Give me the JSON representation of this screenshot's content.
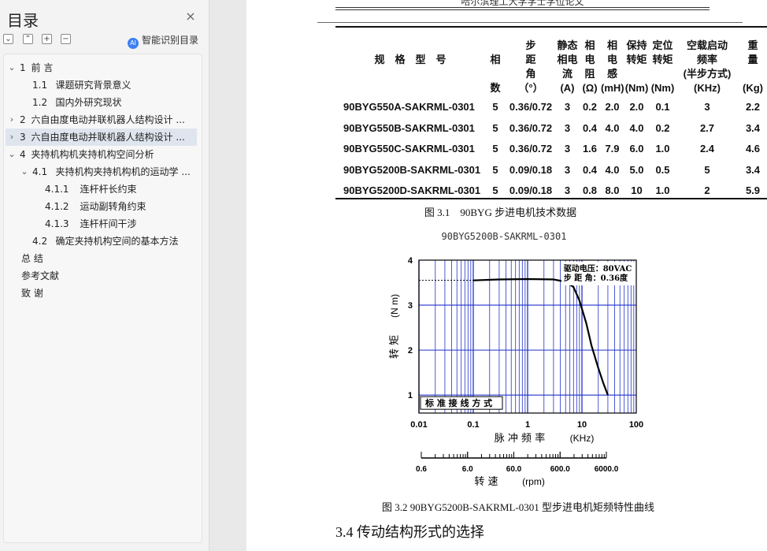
{
  "sidebar": {
    "title": "目录",
    "close_glyph": "×",
    "tool_glyphs": [
      "⌄",
      "⌃",
      "+",
      "−"
    ],
    "smart_icon_text": "AI",
    "smart_label": "智能识别目录",
    "items": [
      {
        "toggle": "⌄",
        "num": "1",
        "text": "前 言",
        "level": 0
      },
      {
        "toggle": "",
        "num": "1.1",
        "text": "课题研究背景意义",
        "level": 1
      },
      {
        "toggle": "",
        "num": "1.2",
        "text": "国内外研究现状",
        "level": 1
      },
      {
        "toggle": "›",
        "num": "2",
        "text": "六自由度电动并联机器人结构设计 ...",
        "level": 0
      },
      {
        "toggle": "›",
        "num": "3",
        "text": "六自由度电动并联机器人结构设计 ...",
        "level": 0
      },
      {
        "toggle": "⌄",
        "num": "4",
        "text": "夹持机构机夹持机构空间分析",
        "level": 0
      },
      {
        "toggle": "⌄",
        "num": "4.1",
        "text": "夹持机构夹持机构机的运动学 ...",
        "level": 1
      },
      {
        "toggle": "",
        "num": "4.1.1",
        "text": "连杆杆长约束",
        "level": 2
      },
      {
        "toggle": "",
        "num": "4.1.2",
        "text": "运动副转角约束",
        "level": 2
      },
      {
        "toggle": "",
        "num": "4.1.3",
        "text": "连杆杆间干涉",
        "level": 2
      },
      {
        "toggle": "",
        "num": "4.2",
        "text": "确定夹持机构空间的基本方法",
        "level": 1
      },
      {
        "toggle": "",
        "num": "",
        "text": "总 结",
        "level": 0
      },
      {
        "toggle": "",
        "num": "",
        "text": "参考文献",
        "level": 0
      },
      {
        "toggle": "",
        "num": "",
        "text": "致 谢",
        "level": 0
      }
    ],
    "selected_index": 4
  },
  "document": {
    "running_header": "哈尔滨理工大学学士学位论文",
    "table": {
      "headers": [
        "规　格　型　号",
        "相\n\n数",
        "步\n距\n角\n（°）",
        "静态\n相电\n流\n(A)",
        "相\n电\n阻\n(Ω)",
        "相\n电\n感\n(mH)",
        "保持\n转矩\n\n(Nm)",
        "定位\n转矩\n\n(Nm)",
        "空载启动\n频率\n(半步方式)\n(KHz)",
        "重\n量\n\n(Kg)"
      ],
      "rows": [
        [
          "90BYG550A-SAKRML-0301",
          "5",
          "0.36/0.72",
          "3",
          "0.2",
          "2.0",
          "2.0",
          "0.1",
          "3",
          "2.2"
        ],
        [
          "90BYG550B-SAKRML-0301",
          "5",
          "0.36/0.72",
          "3",
          "0.4",
          "4.0",
          "4.0",
          "0.2",
          "2.7",
          "3.4"
        ],
        [
          "90BYG550C-SAKRML-0301",
          "5",
          "0.36/0.72",
          "3",
          "1.6",
          "7.9",
          "6.0",
          "1.0",
          "2.4",
          "4.6"
        ],
        [
          "90BYG5200B-SAKRML-0301",
          "5",
          "0.09/0.18",
          "3",
          "0.4",
          "4.0",
          "5.0",
          "0.5",
          "5",
          "3.4"
        ],
        [
          "90BYG5200D-SAKRML-0301",
          "5",
          "0.09/0.18",
          "3",
          "0.8",
          "8.0",
          "10",
          "1.0",
          "2",
          "5.9"
        ]
      ]
    },
    "table_caption": "图 3.1　90BYG 步进电机技术数据",
    "figure_caption": "图 3.2 90BYG5200B-SAKRML-0301 型步进电机矩频特性曲线",
    "section_heading": "3.4 传动结构形式的选择"
  },
  "chart_data": {
    "type": "line",
    "title": "90BYG5200B-SAKRML-0301",
    "xlabel": "脉 冲 频 率",
    "xunit": "(KHz)",
    "ylabel": "转 矩",
    "yunit": "(N m)",
    "x_scale": "log",
    "xlim": [
      0.01,
      100
    ],
    "ylim": [
      0.6,
      4
    ],
    "x_ticks": [
      "0.01",
      "0.1",
      "1",
      "10",
      "100"
    ],
    "y_ticks": [
      "1",
      "2",
      "3",
      "4"
    ],
    "secondary_axis": {
      "label": "转 速",
      "unit": "(rpm)",
      "ticks": [
        "0.6",
        "6.0",
        "60.0",
        "600.0",
        "6000.0"
      ]
    },
    "annotations": [
      "驱动电压：80VAC",
      "步 距 角：0.36度"
    ],
    "legend_box": "标 准 接 线 方 式",
    "reference_level": 3.55,
    "series": [
      {
        "x": [
          0.1,
          0.3,
          1,
          3,
          5,
          7,
          9,
          12,
          15,
          20,
          25,
          30
        ],
        "y": [
          3.55,
          3.57,
          3.58,
          3.57,
          3.52,
          3.4,
          3.1,
          2.6,
          2.1,
          1.6,
          1.25,
          1.0
        ]
      }
    ],
    "colors": {
      "grid": "#2233cc",
      "curve": "#000000"
    },
    "grid": true
  }
}
